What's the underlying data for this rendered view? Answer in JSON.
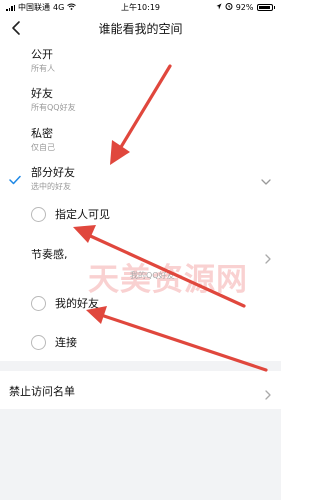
{
  "status_bar": {
    "carrier": "中国联通",
    "network": "4G",
    "time": "上午10:19",
    "battery": "92%"
  },
  "nav": {
    "title": "谁能看我的空间"
  },
  "options": [
    {
      "label": "公开",
      "sub": "所有人"
    },
    {
      "label": "好友",
      "sub": "所有QQ好友"
    },
    {
      "label": "私密",
      "sub": "仅自己"
    },
    {
      "label": "部分好友",
      "sub": "选中的好友",
      "selected": true
    }
  ],
  "sub_options": {
    "specified_label": "指定人可见",
    "group_label": "节奏感,",
    "group_hint": "我的QQ好友",
    "my_friends_label": "我的好友",
    "connect_label": "连接"
  },
  "blocked": {
    "label": "禁止访问名单"
  },
  "watermark": {
    "text": "天美资源网"
  },
  "colors": {
    "accent": "#1e88e5",
    "annotation_arrow": "#e0473d",
    "background_gray": "#f2f3f5"
  }
}
